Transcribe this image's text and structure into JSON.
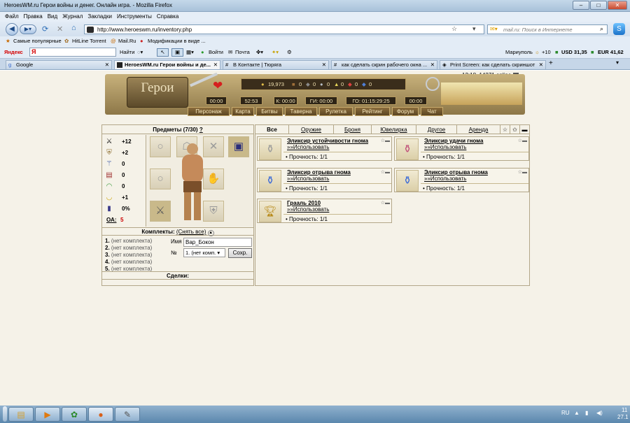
{
  "window": {
    "title": "HeroesWM.ru Герои войны и денег. Онлайн игра. - Mozilla Firefox"
  },
  "menu": [
    "Файл",
    "Правка",
    "Вид",
    "Журнал",
    "Закладки",
    "Инструменты",
    "Справка"
  ],
  "address": {
    "url": "http://www.heroeswm.ru/inventory.php"
  },
  "search": {
    "placeholder": "mail.ru: Поиск в Интернете"
  },
  "bookmarks": [
    "Самые популярные",
    "HitLine Torrent",
    "Mail.Ru",
    "Модификации в виде ..."
  ],
  "yandex": {
    "logo": "Яндекс",
    "find": "Найти",
    "login": "Войти",
    "mail": "Почта",
    "city": "Мариуполь",
    "temp": "+10",
    "usd": "USD 31,35",
    "eur": "EUR 41,62"
  },
  "tabs": [
    {
      "label": "Google"
    },
    {
      "label": "HeroesWM.ru Герои войны и де..."
    },
    {
      "label": "В Контакте | Тюряга"
    },
    {
      "label": "как сделать скрин рабочего окна ..."
    },
    {
      "label": "Print Screen: как сделать скриншот"
    }
  ],
  "game": {
    "online": "12:18, 14271 online",
    "logo": "Герои",
    "resources": {
      "gold": "19,973",
      "wood": "0",
      "ore": "0",
      "mercury": "0",
      "sulfur": "0",
      "crystal": "0",
      "gems": "0"
    },
    "timers": [
      "00:00",
      "52:53",
      "К: 00:00",
      "ГИ: 00:00",
      "ГО: 01:15:29:25",
      "00:00"
    ],
    "nav": [
      "Персонаж",
      "Карта",
      "Битвы",
      "Таверна",
      "Рулетка",
      "Рейтинг",
      "Форум",
      "Чат"
    ],
    "inventory": {
      "title": "Предметы (7/30)",
      "help": "?",
      "stats": [
        {
          "icon": "attack-icon",
          "value": "+12"
        },
        {
          "icon": "defense-icon",
          "value": "+2"
        },
        {
          "icon": "spellpower-icon",
          "value": "0"
        },
        {
          "icon": "knowledge-icon",
          "value": "0"
        },
        {
          "icon": "luck-icon",
          "value": "0"
        },
        {
          "icon": "morale-icon",
          "value": "+1"
        },
        {
          "icon": "initiative-icon",
          "value": "0%"
        }
      ],
      "oa_label": "ОА:",
      "oa_value": "5",
      "kits_title": "Комплекты:",
      "kits_link": "(Снять все)",
      "kits": [
        {
          "n": "1.",
          "t": "(нет комплекта)"
        },
        {
          "n": "2.",
          "t": "(нет комплекта)"
        },
        {
          "n": "3.",
          "t": "(нет комплекта)"
        },
        {
          "n": "4.",
          "t": "(нет комплекта)"
        },
        {
          "n": "5.",
          "t": "(нет комплекта)"
        }
      ],
      "name_label": "Имя",
      "name_value": "Вар_Бокон",
      "num_label": "№",
      "num_value": "1. (нет комп.",
      "save": "Сохр.",
      "deals": "Сделки:"
    },
    "filters": [
      "Все",
      "Оружие",
      "Броня",
      "Ювелирка",
      "Другое",
      "Аренда"
    ],
    "items": [
      {
        "name": "Эликсир устойчивости гнома",
        "use": "»»Использовать",
        "durability": "Прочность: 1/1"
      },
      {
        "name": "Эликсир удачи гнома",
        "use": "»»Использовать",
        "durability": "Прочность: 1/1"
      },
      {
        "name": "Эликсир отрыва гнома",
        "use": "»»Использовать",
        "durability": "Прочность: 1/1"
      },
      {
        "name": "Эликсир отрыва гнома",
        "use": "»»Использовать",
        "durability": "Прочность: 1/1"
      },
      {
        "name": "Грааль 2010",
        "use": "»»Использовать",
        "durability": "Прочность: 1/1"
      }
    ]
  },
  "taskbar": {
    "lang": "RU",
    "time": "11",
    "date": "27.1"
  }
}
